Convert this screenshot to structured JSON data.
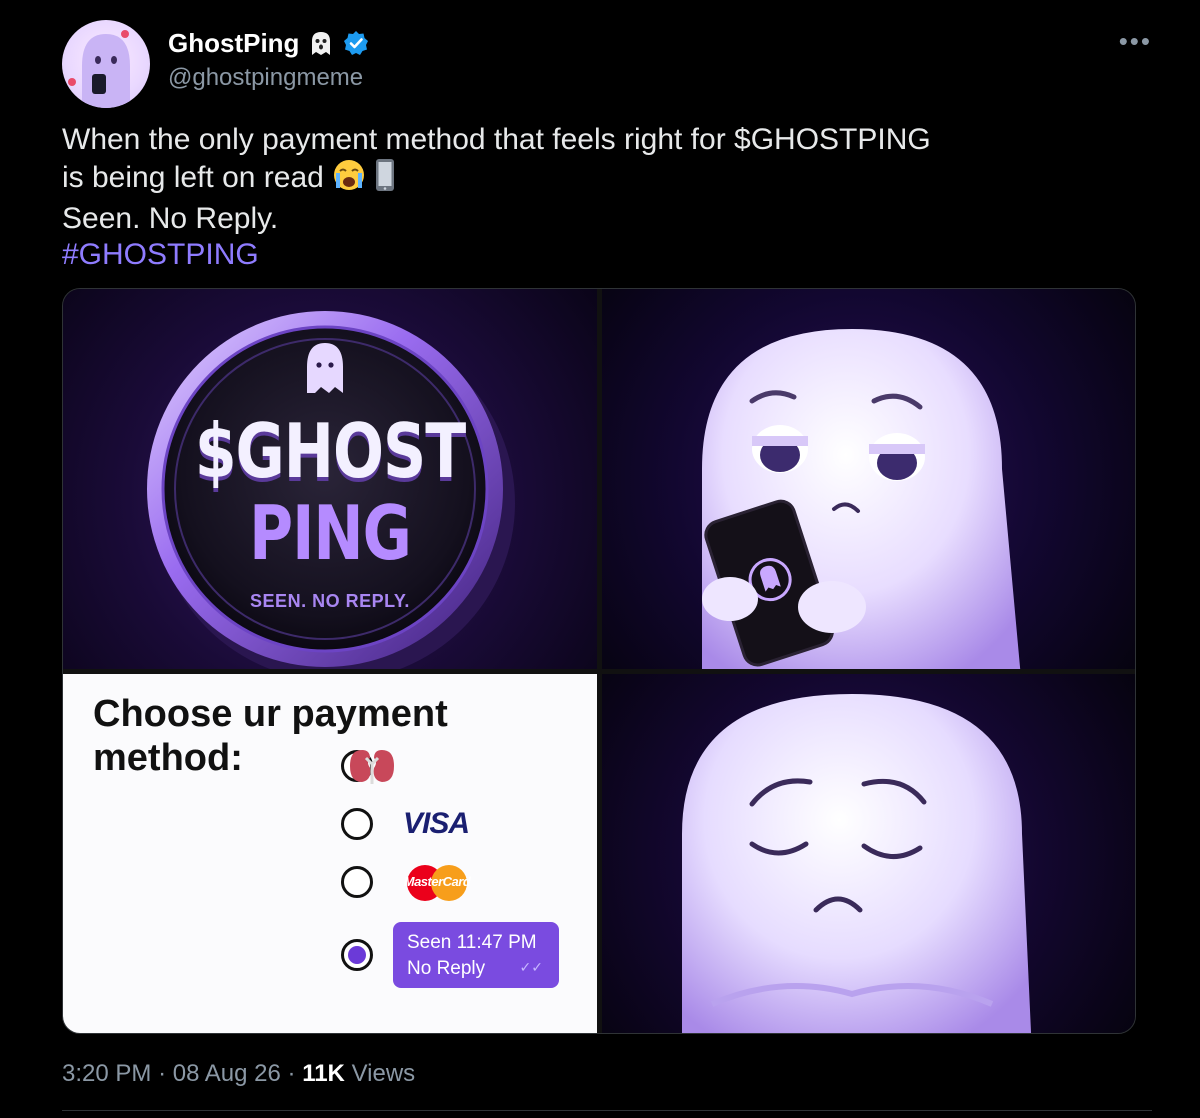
{
  "tweet": {
    "author": {
      "display_name": "GhostPing",
      "name_icon": "ghost-icon",
      "verified": true,
      "handle": "@ghostpingmeme"
    },
    "more_label": "•••",
    "text_lines": [
      "When the only payment method that feels right for $GHOSTPING",
      "is being left on read",
      "Seen. No Reply."
    ],
    "line2_emojis": [
      "loudly-crying-face-icon",
      "mobile-phone-icon"
    ],
    "hashtag": "#GHOSTPING",
    "media": {
      "coin": {
        "line1": "$GHOST",
        "line2": "PING",
        "line3": "SEEN. NO REPLY."
      },
      "payment": {
        "title": "Choose ur payment method:",
        "options": [
          {
            "icon": "kidney-icon",
            "selected": false
          },
          {
            "label": "VISA",
            "selected": false
          },
          {
            "label": "MasterCard",
            "selected": false
          },
          {
            "bubble_line1": "Seen 11:47 PM",
            "bubble_line2": "No Reply",
            "selected": true
          }
        ],
        "read_check": "✓✓"
      }
    },
    "meta": {
      "time": "3:20 PM",
      "separator": "·",
      "date": "08 Aug 26",
      "views_count": "11K",
      "views_label": "Views"
    },
    "colors": {
      "hashtag": "#8f7cff",
      "bubble": "#7a4be0",
      "verified": "#1d9bf0"
    }
  }
}
